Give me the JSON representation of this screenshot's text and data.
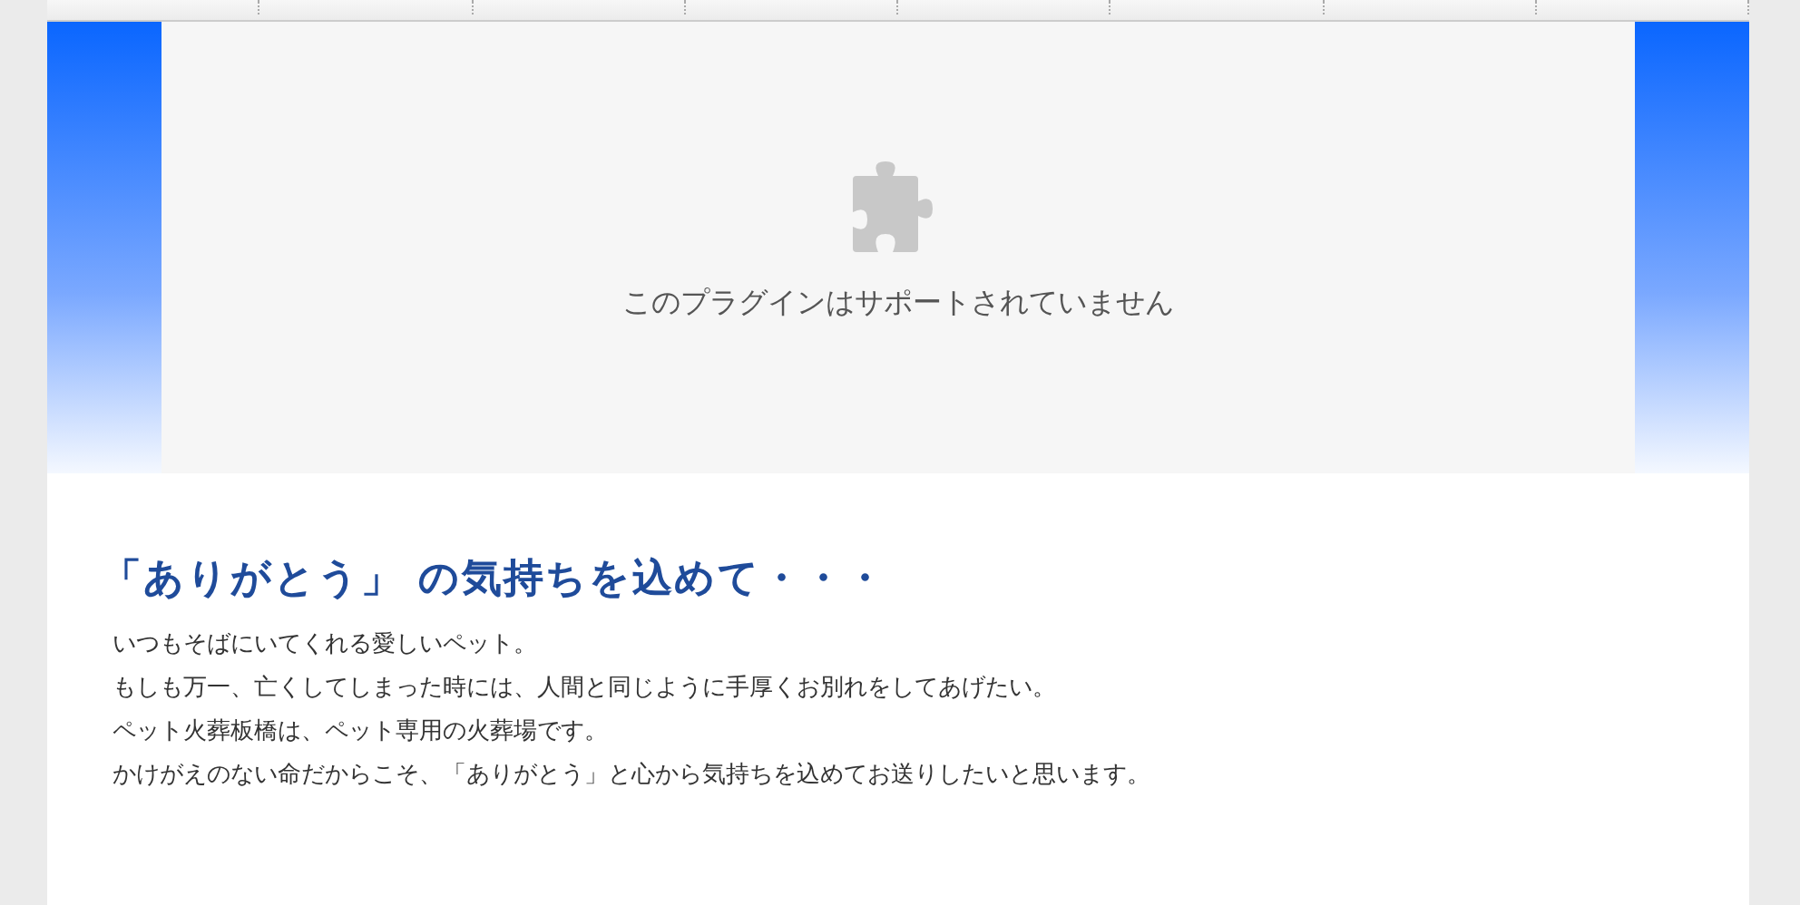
{
  "plugin_notice": {
    "message": "このプラグインはサポートされていません"
  },
  "heading": "「ありがとう」 の気持ちを込めて・・・",
  "intro_lines": [
    "いつもそばにいてくれる愛しいペット。",
    "もしも万一、亡くしてしまった時には、人間と同じように手厚くお別れをしてあげたい。",
    "ペット火葬板橋は、ペット専用の火葬場です。",
    "かけがえのない命だからこそ、「ありがとう」と心から気持ちを込めてお送りしたいと思います。"
  ]
}
